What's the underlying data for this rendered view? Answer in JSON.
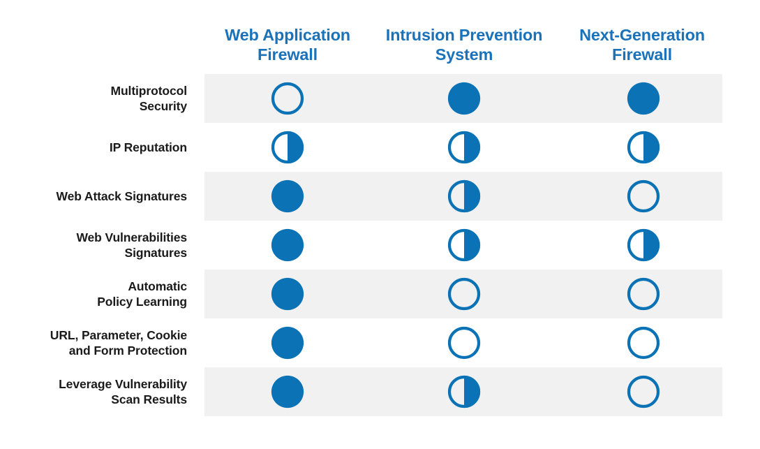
{
  "chart_data": {
    "type": "table",
    "title": "",
    "subtitle": "",
    "xlabel": "",
    "ylabel": "",
    "legend": [],
    "grid": false,
    "scale": {
      "full": "Full support",
      "half": "Partial support",
      "empty": "No support"
    },
    "scale_values": {
      "full": 1,
      "half": 0.5,
      "empty": 0
    },
    "categories": [
      "Multiprotocol Security",
      "IP Reputation",
      "Web Attack Signatures",
      "Web Vulnerabilities Signatures",
      "Automatic Policy Learning",
      "URL, Parameter, Cookie and Form Protection",
      "Leverage Vulnerability Scan Results"
    ],
    "series": [
      {
        "name": "Web Application Firewall",
        "values": [
          0,
          0.5,
          1,
          1,
          1,
          1,
          1
        ]
      },
      {
        "name": "Intrusion Prevention System",
        "values": [
          1,
          0.5,
          0.5,
          0.5,
          0,
          0,
          0.5
        ]
      },
      {
        "name": "Next-Generation Firewall",
        "values": [
          1,
          0.5,
          0,
          0.5,
          0,
          0,
          0
        ]
      }
    ]
  },
  "colors": {
    "accent": "#1a72bb",
    "mark": "#0b72b5",
    "band": "#f1f1f1",
    "label": "#1a1a1a",
    "background": "#ffffff"
  },
  "columns": [
    {
      "label": "Web Application\nFirewall"
    },
    {
      "label": "Intrusion Prevention\nSystem"
    },
    {
      "label": "Next-Generation\nFirewall"
    }
  ],
  "rows": [
    {
      "label": "Multiprotocol\nSecurity",
      "marks": [
        "empty",
        "full",
        "full"
      ],
      "banded": true
    },
    {
      "label": "IP Reputation",
      "marks": [
        "half",
        "half",
        "half"
      ],
      "banded": false
    },
    {
      "label": "Web Attack Signatures",
      "marks": [
        "full",
        "half",
        "empty"
      ],
      "banded": true
    },
    {
      "label": "Web Vulnerabilities\nSignatures",
      "marks": [
        "full",
        "half",
        "half"
      ],
      "banded": false
    },
    {
      "label": "Automatic\nPolicy Learning",
      "marks": [
        "full",
        "empty",
        "empty"
      ],
      "banded": true
    },
    {
      "label": "URL, Parameter, Cookie\nand Form Protection",
      "marks": [
        "full",
        "empty",
        "empty"
      ],
      "banded": false
    },
    {
      "label": "Leverage Vulnerability\nScan Results",
      "marks": [
        "full",
        "half",
        "empty"
      ],
      "banded": true
    }
  ]
}
